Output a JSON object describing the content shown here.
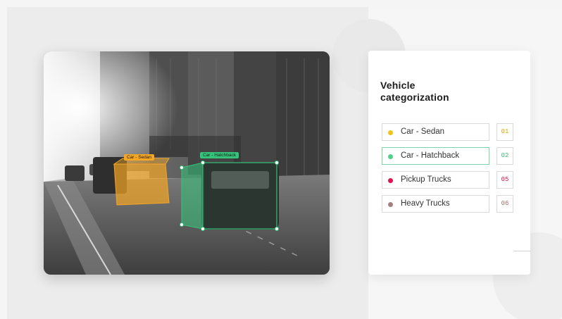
{
  "card": {
    "title": "Vehicle categorization",
    "categories": [
      {
        "label": "Car - Sedan",
        "count": "01",
        "dot_color": "#f2c21b",
        "count_color": "#d9a400",
        "active": false
      },
      {
        "label": "Car - Hatchback",
        "count": "02",
        "dot_color": "#4fcf8c",
        "count_color": "#3fb27a",
        "active": true
      },
      {
        "label": "Pickup Trucks",
        "count": "05",
        "dot_color": "#e0154f",
        "count_color": "#d0154a",
        "active": false
      },
      {
        "label": "Heavy Trucks",
        "count": "06",
        "dot_color": "#a87f7f",
        "count_color": "#9a6f6f",
        "active": false
      }
    ]
  },
  "annotations": [
    {
      "label": "Car - Sedan",
      "color": "#f5a623"
    },
    {
      "label": "Car - Hatchback",
      "color": "#34c47a"
    }
  ]
}
